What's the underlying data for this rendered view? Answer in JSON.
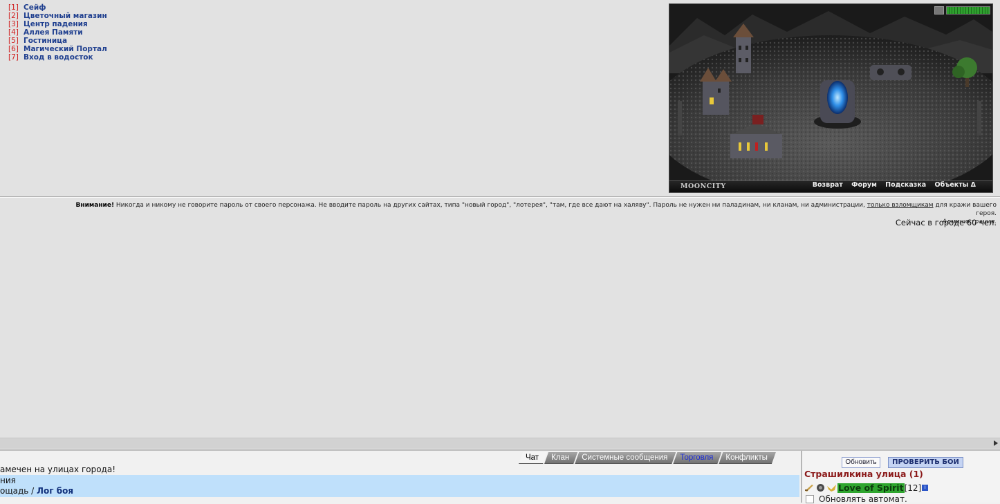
{
  "nav": {
    "items": [
      {
        "num": "[1]",
        "label": "Сейф"
      },
      {
        "num": "[2]",
        "label": "Цветочный магазин"
      },
      {
        "num": "[3]",
        "label": "Центр падения"
      },
      {
        "num": "[4]",
        "label": "Аллея Памяти"
      },
      {
        "num": "[5]",
        "label": "Гостиница"
      },
      {
        "num": "[6]",
        "label": "Магический Портал"
      },
      {
        "num": "[7]",
        "label": "Вход в водосток"
      }
    ]
  },
  "scene": {
    "logo": "MOONCITY",
    "menu": [
      "Возврат",
      "Форум",
      "Подсказка",
      "Объекты Δ"
    ],
    "hp_fraction": 1.0
  },
  "warning": {
    "bold": "Внимание!",
    "text": " Никогда и никому не говорите пароль от своего персонажа. Не вводите пароль на других сайтах, типа \"новый город\", \"лотерея\", \"там, где все дают на халяву\". Пароль не нужен ни паладинам, ни кланам, ни администрации, ",
    "underlined": "только взломщикам",
    "tail": " для кражи вашего героя.",
    "signature": "Администрация."
  },
  "online": "Сейчас в городе 60 чел.",
  "tabs": [
    "Чат",
    "Клан",
    "Системные сообщения",
    "Торговля",
    "Конфликты"
  ],
  "chat": {
    "line1": "амечен на улицах города!",
    "line2": "ния",
    "line3_prefix": "ощадь / ",
    "log_link": "Лог боя"
  },
  "panel": {
    "refresh_label": "Обновить",
    "check_label": "ПРОВЕРИТЬ БОИ",
    "location": "Страшилкина улица (1)",
    "player_name": "Love of Spirit",
    "player_level": "[12]",
    "info_badge": "i",
    "autorefresh_label": "Обновлять автомат."
  },
  "colors": {
    "background": "#e2e2e2",
    "nav_number": "#d02020",
    "nav_link": "#1f3f8f",
    "location": "#8b1a1a",
    "player_highlight": "#2ea52e",
    "chat_highlight": "#bfe0fb"
  }
}
